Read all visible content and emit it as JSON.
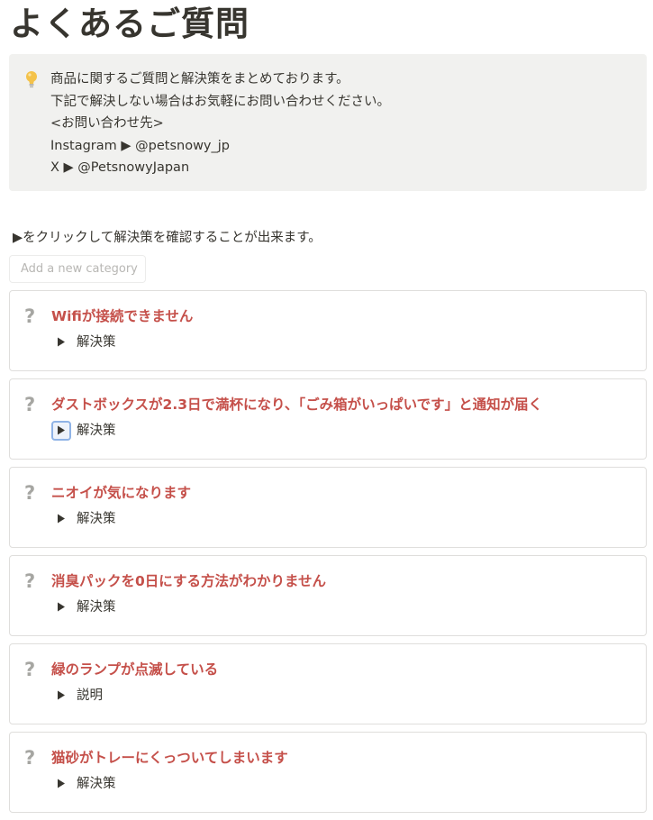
{
  "page": {
    "title": "よくあるご質問",
    "hint": "▶をクリックして解決策を確認することが出来ます。",
    "add_category_placeholder": "Add a new category"
  },
  "callout": {
    "icon": "lightbulb-icon",
    "lines": [
      "商品に関するご質問と解決策をまとめております。",
      "下記で解決しない場合はお気軽にお問い合わせください。",
      "<お問い合わせ先>",
      "Instagram ▶ @petsnowy_jp",
      "X ▶ @PetsnowyJapan"
    ]
  },
  "faqs": [
    {
      "question": "Wifiが接続できません",
      "toggle_label": "解決策"
    },
    {
      "question": "ダストボックスが2.3日で満杯になり、「ごみ箱がいっぱいです」と通知が届く",
      "toggle_label": "解決策"
    },
    {
      "question": "ニオイが気になります",
      "toggle_label": "解決策"
    },
    {
      "question": "消臭パックを0日にする方法がわかりません",
      "toggle_label": "解決策"
    },
    {
      "question": "緑のランプが点滅している",
      "toggle_label": "説明"
    },
    {
      "question": "猫砂がトレーにくっついてしまいます",
      "toggle_label": "解決策"
    }
  ],
  "question_mark": "?",
  "colors": {
    "question_text": "#c5504a",
    "question_mark": "#a6a6a2",
    "callout_bg": "#f1f1ef",
    "focus_ring": "#8fb3e6"
  }
}
